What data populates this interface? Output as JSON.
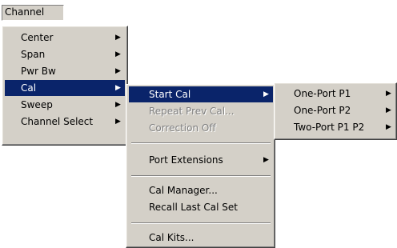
{
  "menubar": {
    "channel_label": "Channel"
  },
  "channel_menu": {
    "items": [
      {
        "label": "Center"
      },
      {
        "label": "Span"
      },
      {
        "label": "Pwr Bw"
      },
      {
        "label": "Cal"
      },
      {
        "label": "Sweep"
      },
      {
        "label": "Channel Select"
      }
    ],
    "selected": "Cal"
  },
  "cal_menu": {
    "items": [
      {
        "label": "Start Cal",
        "state": "selected"
      },
      {
        "label": "Repeat Prev Cal...",
        "state": "disabled"
      },
      {
        "label": "Correction Off",
        "state": "disabled"
      },
      {
        "label": "Port Extensions",
        "state": "enabled"
      },
      {
        "label": "Cal Manager...",
        "state": "enabled"
      },
      {
        "label": "Recall Last Cal Set",
        "state": "enabled"
      },
      {
        "label": "Cal Kits...",
        "state": "enabled"
      }
    ]
  },
  "start_cal_menu": {
    "items": [
      {
        "label": "One-Port P1"
      },
      {
        "label": "One-Port P2"
      },
      {
        "label": "Two-Port P1 P2"
      }
    ]
  },
  "icons": {
    "submenu_arrow": "arrow-right-icon"
  }
}
